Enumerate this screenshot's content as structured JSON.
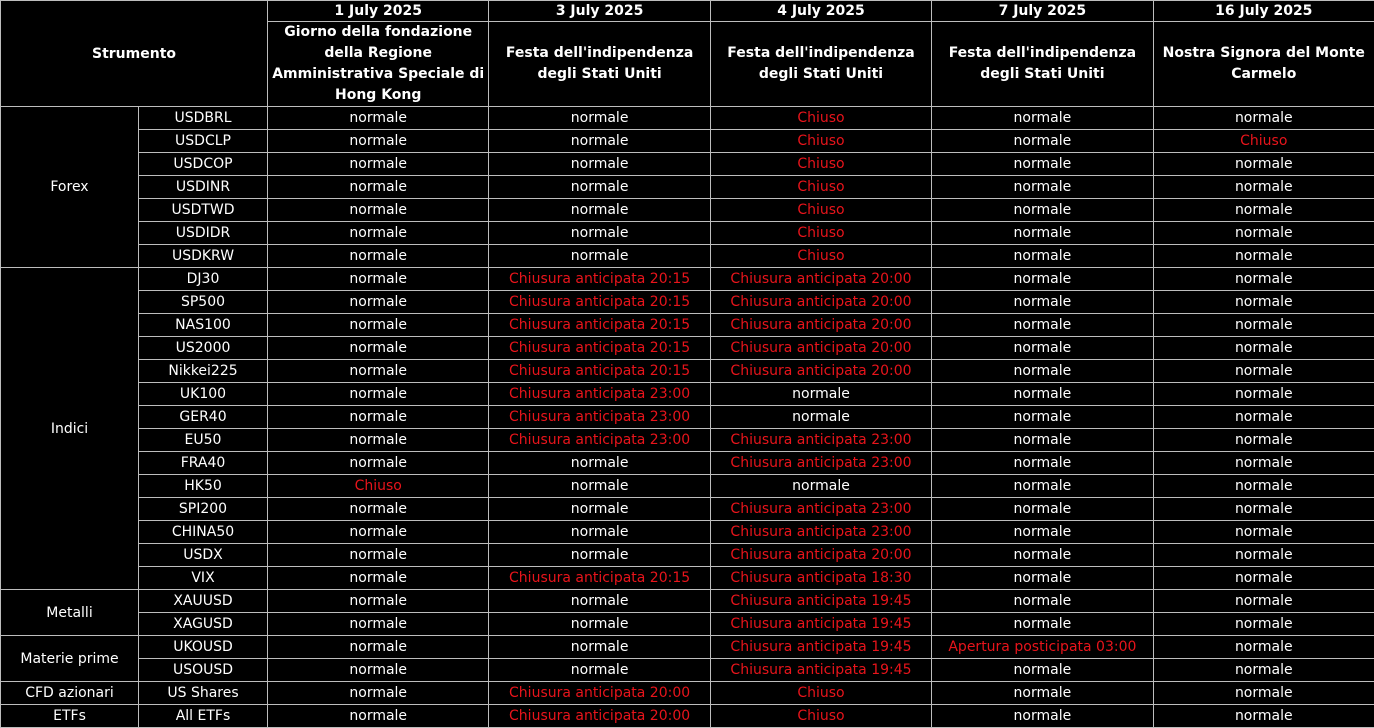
{
  "header": {
    "instrument_label": "Strumento",
    "columns": [
      {
        "date": "1 July 2025",
        "holiday": "Giorno della fondazione della Regione Amministrativa Speciale di Hong Kong"
      },
      {
        "date": "3 July 2025",
        "holiday": "Festa dell'indipendenza degli Stati Uniti"
      },
      {
        "date": "4 July 2025",
        "holiday": "Festa dell'indipendenza degli Stati Uniti"
      },
      {
        "date": "7 July 2025",
        "holiday": "Festa dell'indipendenza degli Stati Uniti"
      },
      {
        "date": "16 July 2025",
        "holiday": "Nostra Signora del Monte Carmelo"
      }
    ]
  },
  "colors": {
    "normal": "#ffffff",
    "changed": "#e8141b",
    "background": "#000000",
    "border": "#bdbdbd"
  },
  "groups": [
    {
      "category": "Forex",
      "rows": [
        {
          "instrument": "USDBRL",
          "values": [
            "normale",
            "normale",
            "Chiuso",
            "normale",
            "normale"
          ]
        },
        {
          "instrument": "USDCLP",
          "values": [
            "normale",
            "normale",
            "Chiuso",
            "normale",
            "Chiuso"
          ]
        },
        {
          "instrument": "USDCOP",
          "values": [
            "normale",
            "normale",
            "Chiuso",
            "normale",
            "normale"
          ]
        },
        {
          "instrument": "USDINR",
          "values": [
            "normale",
            "normale",
            "Chiuso",
            "normale",
            "normale"
          ]
        },
        {
          "instrument": "USDTWD",
          "values": [
            "normale",
            "normale",
            "Chiuso",
            "normale",
            "normale"
          ]
        },
        {
          "instrument": "USDIDR",
          "values": [
            "normale",
            "normale",
            "Chiuso",
            "normale",
            "normale"
          ]
        },
        {
          "instrument": "USDKRW",
          "values": [
            "normale",
            "normale",
            "Chiuso",
            "normale",
            "normale"
          ]
        }
      ]
    },
    {
      "category": "Indici",
      "rows": [
        {
          "instrument": "DJ30",
          "values": [
            "normale",
            "Chiusura anticipata 20:15",
            "Chiusura anticipata 20:00",
            "normale",
            "normale"
          ]
        },
        {
          "instrument": "SP500",
          "values": [
            "normale",
            "Chiusura anticipata 20:15",
            "Chiusura anticipata 20:00",
            "normale",
            "normale"
          ]
        },
        {
          "instrument": "NAS100",
          "values": [
            "normale",
            "Chiusura anticipata 20:15",
            "Chiusura anticipata 20:00",
            "normale",
            "normale"
          ]
        },
        {
          "instrument": "US2000",
          "values": [
            "normale",
            "Chiusura anticipata 20:15",
            "Chiusura anticipata 20:00",
            "normale",
            "normale"
          ]
        },
        {
          "instrument": "Nikkei225",
          "values": [
            "normale",
            "Chiusura anticipata 20:15",
            "Chiusura anticipata 20:00",
            "normale",
            "normale"
          ]
        },
        {
          "instrument": "UK100",
          "values": [
            "normale",
            "Chiusura anticipata 23:00",
            "normale",
            "normale",
            "normale"
          ]
        },
        {
          "instrument": "GER40",
          "values": [
            "normale",
            "Chiusura anticipata 23:00",
            "normale",
            "normale",
            "normale"
          ]
        },
        {
          "instrument": "EU50",
          "values": [
            "normale",
            "Chiusura anticipata 23:00",
            "Chiusura anticipata 23:00",
            "normale",
            "normale"
          ]
        },
        {
          "instrument": "FRA40",
          "values": [
            "normale",
            "normale",
            "Chiusura anticipata 23:00",
            "normale",
            "normale"
          ]
        },
        {
          "instrument": "HK50",
          "values": [
            "Chiuso",
            "normale",
            "normale",
            "normale",
            "normale"
          ]
        },
        {
          "instrument": "SPI200",
          "values": [
            "normale",
            "normale",
            "Chiusura anticipata 23:00",
            "normale",
            "normale"
          ]
        },
        {
          "instrument": "CHINA50",
          "values": [
            "normale",
            "normale",
            "Chiusura anticipata 23:00",
            "normale",
            "normale"
          ]
        },
        {
          "instrument": "USDX",
          "values": [
            "normale",
            "normale",
            "Chiusura anticipata 20:00",
            "normale",
            "normale"
          ]
        },
        {
          "instrument": "VIX",
          "values": [
            "normale",
            "Chiusura anticipata 20:15",
            "Chiusura anticipata 18:30",
            "normale",
            "normale"
          ]
        }
      ]
    },
    {
      "category": "Metalli",
      "rows": [
        {
          "instrument": "XAUUSD",
          "values": [
            "normale",
            "normale",
            "Chiusura anticipata 19:45",
            "normale",
            "normale"
          ]
        },
        {
          "instrument": "XAGUSD",
          "values": [
            "normale",
            "normale",
            "Chiusura anticipata 19:45",
            "normale",
            "normale"
          ]
        }
      ]
    },
    {
      "category": "Materie prime",
      "rows": [
        {
          "instrument": "UKOUSD",
          "values": [
            "normale",
            "normale",
            "Chiusura anticipata 19:45",
            "Apertura posticipata 03:00",
            "normale"
          ]
        },
        {
          "instrument": "USOUSD",
          "values": [
            "normale",
            "normale",
            "Chiusura anticipata 19:45",
            "normale",
            "normale"
          ]
        }
      ]
    },
    {
      "category": "CFD azionari",
      "rows": [
        {
          "instrument": "US Shares",
          "values": [
            "normale",
            "Chiusura anticipata 20:00",
            "Chiuso",
            "normale",
            "normale"
          ]
        }
      ]
    },
    {
      "category": "ETFs",
      "rows": [
        {
          "instrument": "All ETFs",
          "values": [
            "normale",
            "Chiusura anticipata 20:00",
            "Chiuso",
            "normale",
            "normale"
          ]
        }
      ]
    }
  ]
}
